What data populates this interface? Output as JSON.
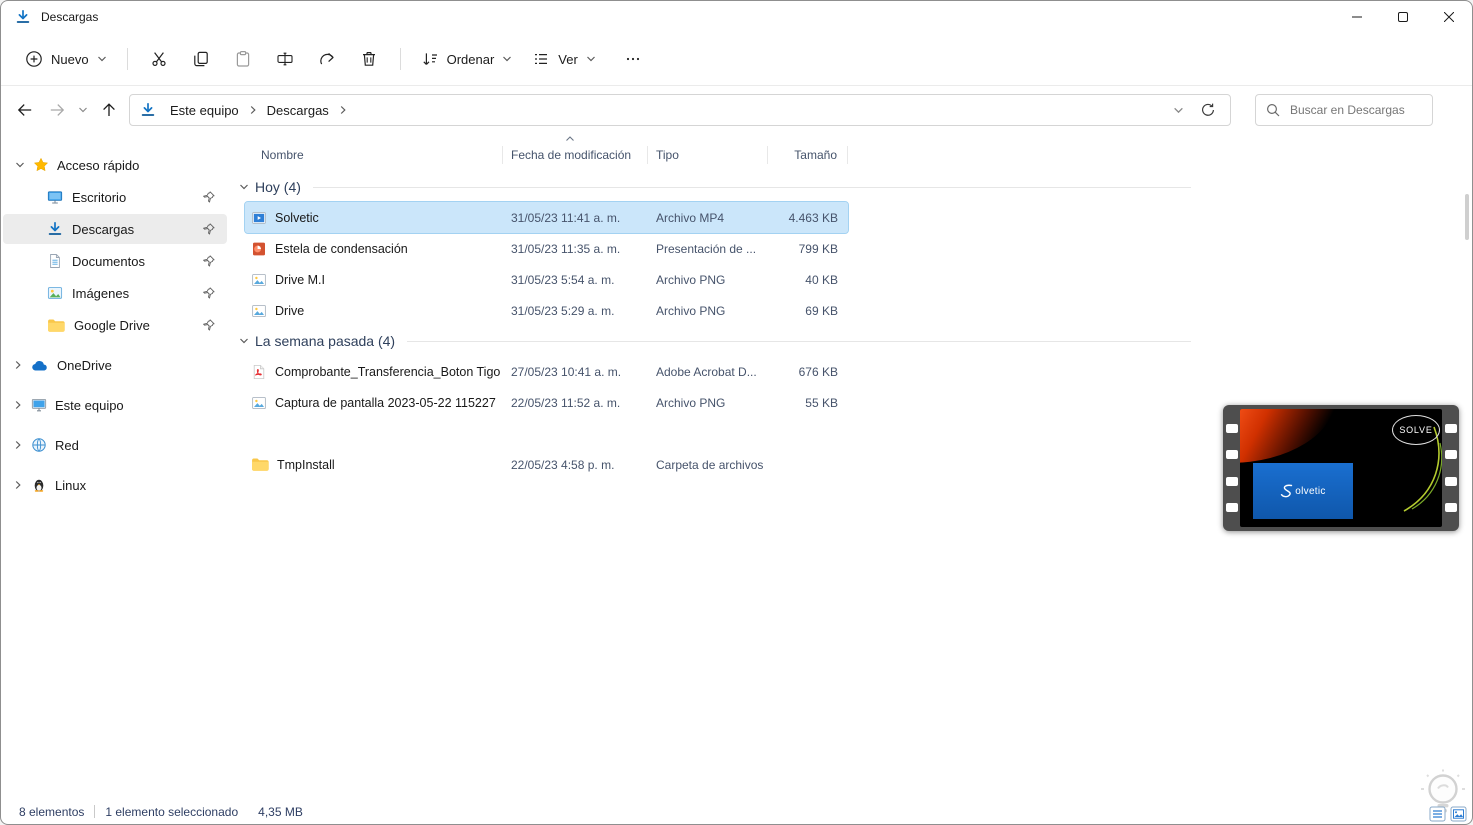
{
  "window": {
    "title": "Descargas"
  },
  "toolbar": {
    "new": {
      "label": "Nuevo",
      "icon": "plus-circle-icon"
    },
    "buttons": [
      {
        "icon": "cut-icon"
      },
      {
        "icon": "copy-icon"
      },
      {
        "icon": "paste-icon",
        "disabled": true
      },
      {
        "icon": "rename-icon"
      },
      {
        "icon": "share-icon"
      },
      {
        "icon": "delete-icon"
      }
    ],
    "sort": {
      "label": "Ordenar",
      "icon": "sort-icon"
    },
    "view": {
      "label": "Ver",
      "icon": "view-icon"
    },
    "more": {
      "icon": "more-icon"
    }
  },
  "navbar": {
    "breadcrumb": [
      "Este equipo",
      "Descargas"
    ],
    "search_placeholder": "Buscar en Descargas"
  },
  "sidebar": {
    "quick_access": {
      "label": "Acceso rápido",
      "icon": "star-icon"
    },
    "items": [
      {
        "label": "Escritorio",
        "icon": "desktop-icon",
        "pinned": true
      },
      {
        "label": "Descargas",
        "icon": "downloads-icon",
        "pinned": true,
        "selected": true
      },
      {
        "label": "Documentos",
        "icon": "documents-icon",
        "pinned": true
      },
      {
        "label": "Imágenes",
        "icon": "pictures-icon",
        "pinned": true
      },
      {
        "label": "Google Drive",
        "icon": "folder-icon",
        "pinned": true
      }
    ],
    "roots": [
      {
        "label": "OneDrive",
        "icon": "onedrive-icon"
      },
      {
        "label": "Este equipo",
        "icon": "computer-icon"
      },
      {
        "label": "Red",
        "icon": "network-icon"
      },
      {
        "label": "Linux",
        "icon": "linux-icon"
      }
    ]
  },
  "filelist": {
    "columns": [
      "Nombre",
      "Fecha de modificación",
      "Tipo",
      "Tamaño"
    ],
    "sorted_column": "Fecha de modificación",
    "groups": [
      {
        "label": "Hoy (4)",
        "items": [
          {
            "name": "Solvetic",
            "date": "31/05/23 11:41 a. m.",
            "type": "Archivo MP4",
            "size": "4.463 KB",
            "icon": "mp4-file-icon",
            "selected": true
          },
          {
            "name": "Estela de condensación",
            "date": "31/05/23 11:35 a. m.",
            "type": "Presentación de ...",
            "size": "799 KB",
            "icon": "ppt-file-icon"
          },
          {
            "name": "Drive M.I",
            "date": "31/05/23 5:54 a. m.",
            "type": "Archivo PNG",
            "size": "40 KB",
            "icon": "png-file-icon"
          },
          {
            "name": "Drive",
            "date": "31/05/23 5:29 a. m.",
            "type": "Archivo PNG",
            "size": "69 KB",
            "icon": "png-file-icon"
          }
        ]
      },
      {
        "label": "La semana pasada (4)",
        "items": [
          {
            "name": "Comprobante_Transferencia_Boton Tigo",
            "date": "27/05/23 10:41 a. m.",
            "type": "Adobe Acrobat D...",
            "size": "676 KB",
            "icon": "pdf-file-icon"
          },
          {
            "name": "Captura de pantalla 2023-05-22 115227",
            "date": "22/05/23 11:52 a. m.",
            "type": "Archivo PNG",
            "size": "55 KB",
            "icon": "png-file-icon"
          },
          {
            "name": "TmpInstall",
            "date": "22/05/23 4:58 p. m.",
            "type": "Carpeta de archivos",
            "size": "",
            "icon": "folder-icon",
            "gap_before": true
          }
        ]
      }
    ]
  },
  "statusbar": {
    "total": "8 elementos",
    "selected": "1 elemento seleccionado",
    "size": "4,35 MB"
  },
  "preview": {
    "brand_top": "SOLVE",
    "brand_logo": "olvetic"
  }
}
